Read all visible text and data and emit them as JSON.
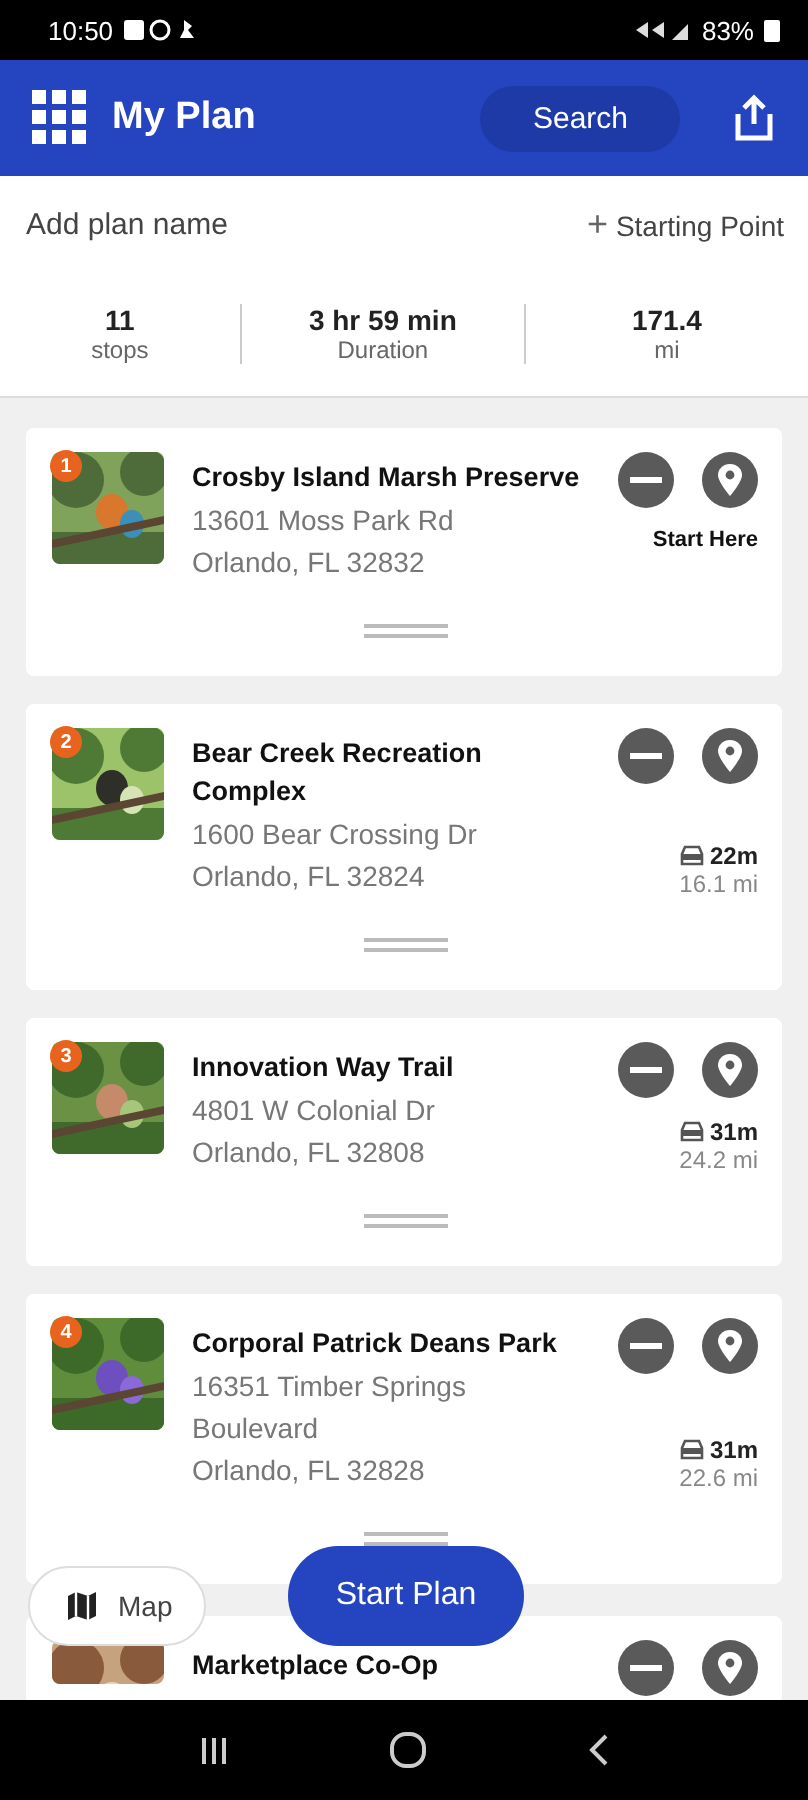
{
  "status_bar": {
    "time": "10:50",
    "battery": "83%"
  },
  "header": {
    "title": "My Plan",
    "search": "Search"
  },
  "plan": {
    "name_placeholder": "Add plan name",
    "starting_point": "Starting Point",
    "plus": "+"
  },
  "stats": [
    {
      "value": "11",
      "label": "stops"
    },
    {
      "value": "3 hr 59 min",
      "label": "Duration"
    },
    {
      "value": "171.4",
      "label": "mi"
    }
  ],
  "stops": [
    {
      "number": "1",
      "name": "Crosby Island Marsh Preserve",
      "address": [
        "13601 Moss Park Rd",
        "Orlando, FL 32832"
      ],
      "kind": "start",
      "start_label": "Start Here"
    },
    {
      "number": "2",
      "name": "Bear Creek Recreation Complex",
      "address": [
        "1600 Bear Crossing Dr",
        "Orlando, FL 32824"
      ],
      "kind": "drive",
      "drive_time": "22m",
      "distance": "16.1 mi"
    },
    {
      "number": "3",
      "name": "Innovation Way Trail",
      "address": [
        "4801 W Colonial Dr",
        "Orlando, FL 32808"
      ],
      "kind": "drive",
      "drive_time": "31m",
      "distance": "24.2 mi"
    },
    {
      "number": "4",
      "name": "Corporal Patrick Deans Park",
      "address": [
        "16351 Timber Springs Boulevard",
        "Orlando, FL 32828"
      ],
      "kind": "drive",
      "drive_time": "31m",
      "distance": "22.6 mi"
    },
    {
      "name": "Marketplace Co-Op",
      "kind": "partial"
    }
  ],
  "map_button": "Map",
  "start_button": "Start Plan"
}
